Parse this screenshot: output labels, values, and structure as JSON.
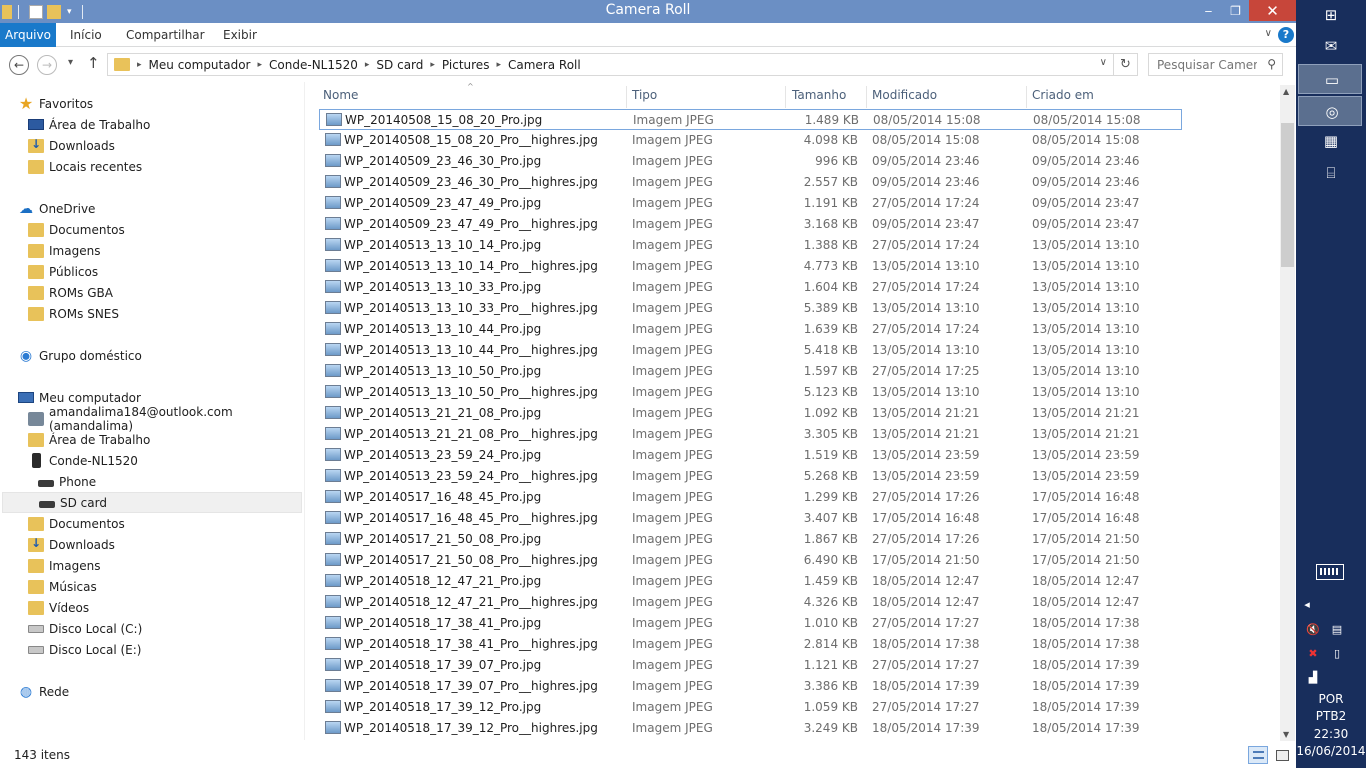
{
  "window": {
    "title": "Camera Roll",
    "minimize": "‒",
    "maximize": "❐",
    "close": "✕"
  },
  "ribbon": {
    "tabs": [
      "Arquivo",
      "Início",
      "Compartilhar",
      "Exibir"
    ],
    "help": "?"
  },
  "address": {
    "crumbs": [
      "Meu computador",
      "Conde-NL1520",
      "SD card",
      "Pictures",
      "Camera Roll"
    ]
  },
  "search": {
    "placeholder": "Pesquisar Camer..."
  },
  "nav": {
    "items": [
      {
        "label": "Favoritos",
        "icon": "star-icon"
      },
      {
        "label": "Área de Trabalho",
        "icon": "desktop-icon"
      },
      {
        "label": "Downloads",
        "icon": "downloads-icon"
      },
      {
        "label": "Locais recentes",
        "icon": "recent-places-icon"
      },
      {
        "label": "OneDrive",
        "icon": "onedrive-icon"
      },
      {
        "label": "Documentos",
        "icon": "folder-icon"
      },
      {
        "label": "Imagens",
        "icon": "folder-icon"
      },
      {
        "label": "Públicos",
        "icon": "folder-icon"
      },
      {
        "label": "ROMs GBA",
        "icon": "folder-icon"
      },
      {
        "label": "ROMs SNES",
        "icon": "folder-icon"
      },
      {
        "label": "Grupo doméstico",
        "icon": "homegroup-icon"
      },
      {
        "label": "Meu computador",
        "icon": "computer-icon"
      },
      {
        "label": "amandalima184@outlook.com (amandalima)",
        "icon": "user-icon"
      },
      {
        "label": "Área de Trabalho",
        "icon": "desktop-icon"
      },
      {
        "label": "Conde-NL1520",
        "icon": "phone-icon"
      },
      {
        "label": "Phone",
        "icon": "drive-icon"
      },
      {
        "label": "SD card",
        "icon": "drive-icon"
      },
      {
        "label": "Documentos",
        "icon": "documents-icon"
      },
      {
        "label": "Downloads",
        "icon": "downloads-icon"
      },
      {
        "label": "Imagens",
        "icon": "pictures-icon"
      },
      {
        "label": "Músicas",
        "icon": "music-icon"
      },
      {
        "label": "Vídeos",
        "icon": "videos-icon"
      },
      {
        "label": "Disco Local (C:)",
        "icon": "disk-icon"
      },
      {
        "label": "Disco Local (E:)",
        "icon": "disk-icon"
      },
      {
        "label": "Rede",
        "icon": "network-icon"
      }
    ],
    "selected": "SD card"
  },
  "columns": [
    "Nome",
    "Tipo",
    "Tamanho",
    "Modificado",
    "Criado em"
  ],
  "files": [
    [
      "WP_20140508_15_08_20_Pro.jpg",
      "Imagem JPEG",
      "1.489 KB",
      "08/05/2014 15:08",
      "08/05/2014 15:08"
    ],
    [
      "WP_20140508_15_08_20_Pro__highres.jpg",
      "Imagem JPEG",
      "4.098 KB",
      "08/05/2014 15:08",
      "08/05/2014 15:08"
    ],
    [
      "WP_20140509_23_46_30_Pro.jpg",
      "Imagem JPEG",
      "996 KB",
      "09/05/2014 23:46",
      "09/05/2014 23:46"
    ],
    [
      "WP_20140509_23_46_30_Pro__highres.jpg",
      "Imagem JPEG",
      "2.557 KB",
      "09/05/2014 23:46",
      "09/05/2014 23:46"
    ],
    [
      "WP_20140509_23_47_49_Pro.jpg",
      "Imagem JPEG",
      "1.191 KB",
      "27/05/2014 17:24",
      "09/05/2014 23:47"
    ],
    [
      "WP_20140509_23_47_49_Pro__highres.jpg",
      "Imagem JPEG",
      "3.168 KB",
      "09/05/2014 23:47",
      "09/05/2014 23:47"
    ],
    [
      "WP_20140513_13_10_14_Pro.jpg",
      "Imagem JPEG",
      "1.388 KB",
      "27/05/2014 17:24",
      "13/05/2014 13:10"
    ],
    [
      "WP_20140513_13_10_14_Pro__highres.jpg",
      "Imagem JPEG",
      "4.773 KB",
      "13/05/2014 13:10",
      "13/05/2014 13:10"
    ],
    [
      "WP_20140513_13_10_33_Pro.jpg",
      "Imagem JPEG",
      "1.604 KB",
      "27/05/2014 17:24",
      "13/05/2014 13:10"
    ],
    [
      "WP_20140513_13_10_33_Pro__highres.jpg",
      "Imagem JPEG",
      "5.389 KB",
      "13/05/2014 13:10",
      "13/05/2014 13:10"
    ],
    [
      "WP_20140513_13_10_44_Pro.jpg",
      "Imagem JPEG",
      "1.639 KB",
      "27/05/2014 17:24",
      "13/05/2014 13:10"
    ],
    [
      "WP_20140513_13_10_44_Pro__highres.jpg",
      "Imagem JPEG",
      "5.418 KB",
      "13/05/2014 13:10",
      "13/05/2014 13:10"
    ],
    [
      "WP_20140513_13_10_50_Pro.jpg",
      "Imagem JPEG",
      "1.597 KB",
      "27/05/2014 17:25",
      "13/05/2014 13:10"
    ],
    [
      "WP_20140513_13_10_50_Pro__highres.jpg",
      "Imagem JPEG",
      "5.123 KB",
      "13/05/2014 13:10",
      "13/05/2014 13:10"
    ],
    [
      "WP_20140513_21_21_08_Pro.jpg",
      "Imagem JPEG",
      "1.092 KB",
      "13/05/2014 21:21",
      "13/05/2014 21:21"
    ],
    [
      "WP_20140513_21_21_08_Pro__highres.jpg",
      "Imagem JPEG",
      "3.305 KB",
      "13/05/2014 21:21",
      "13/05/2014 21:21"
    ],
    [
      "WP_20140513_23_59_24_Pro.jpg",
      "Imagem JPEG",
      "1.519 KB",
      "13/05/2014 23:59",
      "13/05/2014 23:59"
    ],
    [
      "WP_20140513_23_59_24_Pro__highres.jpg",
      "Imagem JPEG",
      "5.268 KB",
      "13/05/2014 23:59",
      "13/05/2014 23:59"
    ],
    [
      "WP_20140517_16_48_45_Pro.jpg",
      "Imagem JPEG",
      "1.299 KB",
      "27/05/2014 17:26",
      "17/05/2014 16:48"
    ],
    [
      "WP_20140517_16_48_45_Pro__highres.jpg",
      "Imagem JPEG",
      "3.407 KB",
      "17/05/2014 16:48",
      "17/05/2014 16:48"
    ],
    [
      "WP_20140517_21_50_08_Pro.jpg",
      "Imagem JPEG",
      "1.867 KB",
      "27/05/2014 17:26",
      "17/05/2014 21:50"
    ],
    [
      "WP_20140517_21_50_08_Pro__highres.jpg",
      "Imagem JPEG",
      "6.490 KB",
      "17/05/2014 21:50",
      "17/05/2014 21:50"
    ],
    [
      "WP_20140518_12_47_21_Pro.jpg",
      "Imagem JPEG",
      "1.459 KB",
      "18/05/2014 12:47",
      "18/05/2014 12:47"
    ],
    [
      "WP_20140518_12_47_21_Pro__highres.jpg",
      "Imagem JPEG",
      "4.326 KB",
      "18/05/2014 12:47",
      "18/05/2014 12:47"
    ],
    [
      "WP_20140518_17_38_41_Pro.jpg",
      "Imagem JPEG",
      "1.010 KB",
      "27/05/2014 17:27",
      "18/05/2014 17:38"
    ],
    [
      "WP_20140518_17_38_41_Pro__highres.jpg",
      "Imagem JPEG",
      "2.814 KB",
      "18/05/2014 17:38",
      "18/05/2014 17:38"
    ],
    [
      "WP_20140518_17_39_07_Pro.jpg",
      "Imagem JPEG",
      "1.121 KB",
      "27/05/2014 17:27",
      "18/05/2014 17:39"
    ],
    [
      "WP_20140518_17_39_07_Pro__highres.jpg",
      "Imagem JPEG",
      "3.386 KB",
      "18/05/2014 17:39",
      "18/05/2014 17:39"
    ],
    [
      "WP_20140518_17_39_12_Pro.jpg",
      "Imagem JPEG",
      "1.059 KB",
      "27/05/2014 17:27",
      "18/05/2014 17:39"
    ],
    [
      "WP_20140518_17_39_12_Pro__highres.jpg",
      "Imagem JPEG",
      "3.249 KB",
      "18/05/2014 17:39",
      "18/05/2014 17:39"
    ]
  ],
  "status": {
    "count": "143 itens"
  },
  "taskbar": {
    "lang1": "POR",
    "lang2": "PTB2",
    "time": "22:30",
    "date": "16/06/2014"
  },
  "colors": {
    "titlebar": "#6b8fc4",
    "file_tab": "#1979ca",
    "close": "#c7463a",
    "taskbar": "#182e5c"
  }
}
